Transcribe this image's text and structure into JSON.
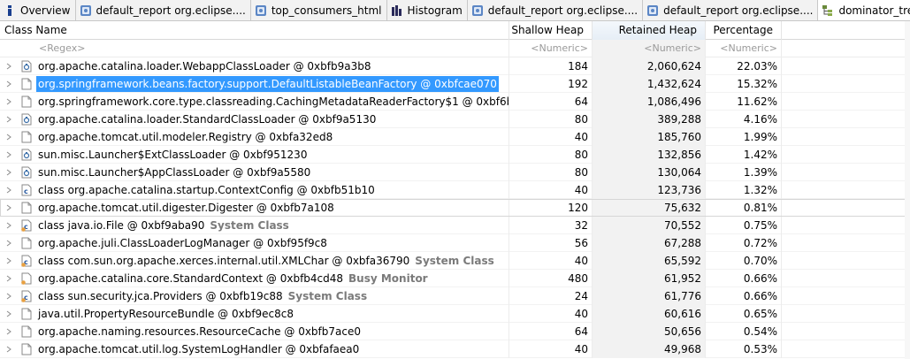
{
  "tabs": [
    {
      "label": "Overview",
      "icon": "info-icon",
      "active": false
    },
    {
      "label": "default_report  org.eclipse....",
      "icon": "report-icon",
      "active": false
    },
    {
      "label": "top_consumers_html",
      "icon": "report-icon",
      "active": false
    },
    {
      "label": "Histogram",
      "icon": "histogram-icon",
      "active": false
    },
    {
      "label": "default_report  org.eclipse....",
      "icon": "report-icon",
      "active": false
    },
    {
      "label": "default_report  org.eclipse....",
      "icon": "report-icon",
      "active": false
    },
    {
      "label": "dominator_tree",
      "icon": "tree-icon",
      "active": true
    }
  ],
  "columns": {
    "name": "Class Name",
    "shallow": "Shallow Heap",
    "retained": "Retained Heap",
    "percentage": "Percentage"
  },
  "filters": {
    "name": "<Regex>",
    "shallow": "<Numeric>",
    "retained": "<Numeric>",
    "percentage": "<Numeric>"
  },
  "rows": [
    {
      "name": "org.apache.catalina.loader.WebappClassLoader @ 0xbfb9a3b8",
      "extra": "",
      "shallow": "184",
      "retained": "2,060,624",
      "percentage": "22.03%",
      "icon": "classloader-icon"
    },
    {
      "name": "org.springframework.beans.factory.support.DefaultListableBeanFactory @ 0xbfcae070",
      "extra": "",
      "shallow": "192",
      "retained": "1,432,624",
      "percentage": "15.32%",
      "icon": "object-icon"
    },
    {
      "name": "org.springframework.core.type.classreading.CachingMetadataReaderFactory$1 @ 0xbf6b9f",
      "extra": "",
      "shallow": "64",
      "retained": "1,086,496",
      "percentage": "11.62%",
      "icon": "object-icon"
    },
    {
      "name": "org.apache.catalina.loader.StandardClassLoader @ 0xbf9a5130",
      "extra": "",
      "shallow": "80",
      "retained": "389,288",
      "percentage": "4.16%",
      "icon": "classloader-icon"
    },
    {
      "name": "org.apache.tomcat.util.modeler.Registry @ 0xbfa32ed8",
      "extra": "",
      "shallow": "40",
      "retained": "185,760",
      "percentage": "1.99%",
      "icon": "object-icon"
    },
    {
      "name": "sun.misc.Launcher$ExtClassLoader @ 0xbf951230",
      "extra": "",
      "shallow": "80",
      "retained": "132,856",
      "percentage": "1.42%",
      "icon": "classloader-icon"
    },
    {
      "name": "sun.misc.Launcher$AppClassLoader @ 0xbf9a5580",
      "extra": "",
      "shallow": "80",
      "retained": "130,064",
      "percentage": "1.39%",
      "icon": "classloader-icon"
    },
    {
      "name": "class org.apache.catalina.startup.ContextConfig @ 0xbfb51b10",
      "extra": "",
      "shallow": "40",
      "retained": "123,736",
      "percentage": "1.32%",
      "icon": "class-icon"
    },
    {
      "name": "org.apache.tomcat.util.digester.Digester @ 0xbfb7a108",
      "extra": "",
      "shallow": "120",
      "retained": "75,632",
      "percentage": "0.81%",
      "icon": "object-icon"
    },
    {
      "name": "class java.io.File @ 0xbf9aba90",
      "extra": "System Class",
      "shallow": "32",
      "retained": "70,552",
      "percentage": "0.75%",
      "icon": "system-class-icon"
    },
    {
      "name": "org.apache.juli.ClassLoaderLogManager @ 0xbf95f9c8",
      "extra": "",
      "shallow": "56",
      "retained": "67,288",
      "percentage": "0.72%",
      "icon": "object-icon"
    },
    {
      "name": "class com.sun.org.apache.xerces.internal.util.XMLChar @ 0xbfa36790",
      "extra": "System Class",
      "shallow": "40",
      "retained": "65,592",
      "percentage": "0.70%",
      "icon": "system-class-icon"
    },
    {
      "name": "org.apache.catalina.core.StandardContext @ 0xbfb4cd48",
      "extra": "Busy Monitor",
      "shallow": "480",
      "retained": "61,952",
      "percentage": "0.66%",
      "icon": "monitor-object-icon"
    },
    {
      "name": "class sun.security.jca.Providers @ 0xbfb19c88",
      "extra": "System Class",
      "shallow": "24",
      "retained": "61,776",
      "percentage": "0.66%",
      "icon": "system-class-icon"
    },
    {
      "name": "java.util.PropertyResourceBundle @ 0xbf9ec8c8",
      "extra": "",
      "shallow": "40",
      "retained": "60,616",
      "percentage": "0.65%",
      "icon": "object-icon"
    },
    {
      "name": "org.apache.naming.resources.ResourceCache @ 0xbfb7ace0",
      "extra": "",
      "shallow": "64",
      "retained": "50,656",
      "percentage": "0.54%",
      "icon": "object-icon"
    },
    {
      "name": "org.apache.tomcat.util.log.SystemLogHandler @ 0xbfafaea0",
      "extra": "",
      "shallow": "40",
      "retained": "49,968",
      "percentage": "0.53%",
      "icon": "object-icon"
    }
  ],
  "selected_row": 1,
  "focused_row": 8,
  "colors": {
    "selection": "#3399ff",
    "icon_orange": "#e8a040",
    "icon_blue": "#3a6ea8"
  }
}
